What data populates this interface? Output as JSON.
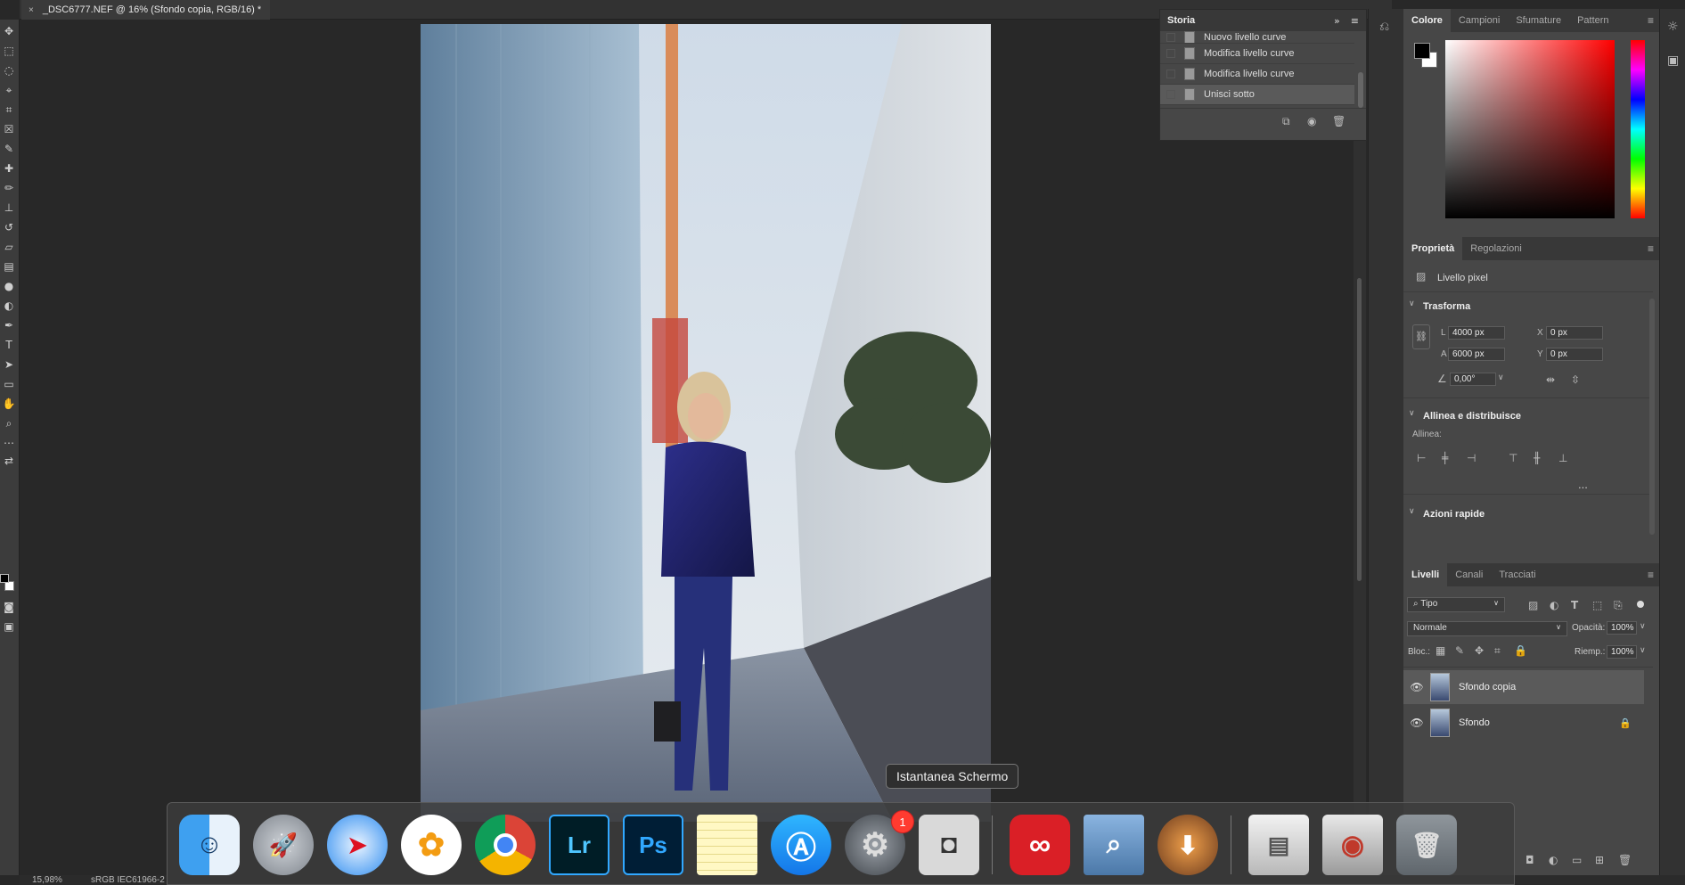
{
  "document": {
    "tab_title": "_DSC6777.NEF @ 16% (Sfondo copia, RGB/16) *",
    "close_glyph": "×",
    "zoom": "15,98%",
    "profile": "sRGB IEC61966-2"
  },
  "storia": {
    "title": "Storia",
    "items": [
      {
        "label": "Nuovo livello curve"
      },
      {
        "label": "Modifica livello curve"
      },
      {
        "label": "Modifica livello curve"
      },
      {
        "label": "Unisci sotto",
        "selected": true
      }
    ]
  },
  "color_panel": {
    "tabs": [
      "Colore",
      "Campioni",
      "Sfumature",
      "Pattern"
    ],
    "active_tab": "Colore"
  },
  "properties_panel": {
    "tabs": [
      "Proprietà",
      "Regolazioni"
    ],
    "layer_kind": "Livello pixel",
    "transform": {
      "title": "Trasforma",
      "l_label": "L",
      "l_value": "4000 px",
      "a_label": "A",
      "a_value": "6000 px",
      "x_label": "X",
      "x_value": "0 px",
      "y_label": "Y",
      "y_value": "0 px",
      "angle": "0,00°"
    },
    "align": {
      "title": "Allinea e distribuisce",
      "label": "Allinea:",
      "more": "..."
    },
    "quick_actions": "Azioni rapide"
  },
  "layers_panel": {
    "tabs": [
      "Livelli",
      "Canali",
      "Tracciati"
    ],
    "filter": "Tipo",
    "blend_mode": "Normale",
    "opacity_label": "Opacità:",
    "opacity": "100%",
    "lock_label": "Bloc.:",
    "fill_label": "Riemp.:",
    "fill": "100%",
    "layers": [
      {
        "name": "Sfondo copia",
        "selected": true
      },
      {
        "name": "Sfondo",
        "locked": true
      }
    ]
  },
  "dock": {
    "tooltip": "Istantanea Schermo",
    "badge": "1",
    "apps": [
      "Finder",
      "Launchpad",
      "Safari",
      "Foto",
      "Chrome",
      "Lightroom",
      "Photoshop",
      "Note",
      "App Store",
      "Preferenze di Sistema",
      "Istantanea Schermo",
      "Creative Cloud",
      "Anteprima",
      "Installa macOS",
      "Utility",
      "Photo Booth",
      "Cestino"
    ],
    "lr_label": "Lr",
    "ps_label": "Ps"
  },
  "colors": {
    "accent_blue": "#31a8ff",
    "badge_red": "#ff3b30",
    "cc_red": "#da1f26"
  }
}
